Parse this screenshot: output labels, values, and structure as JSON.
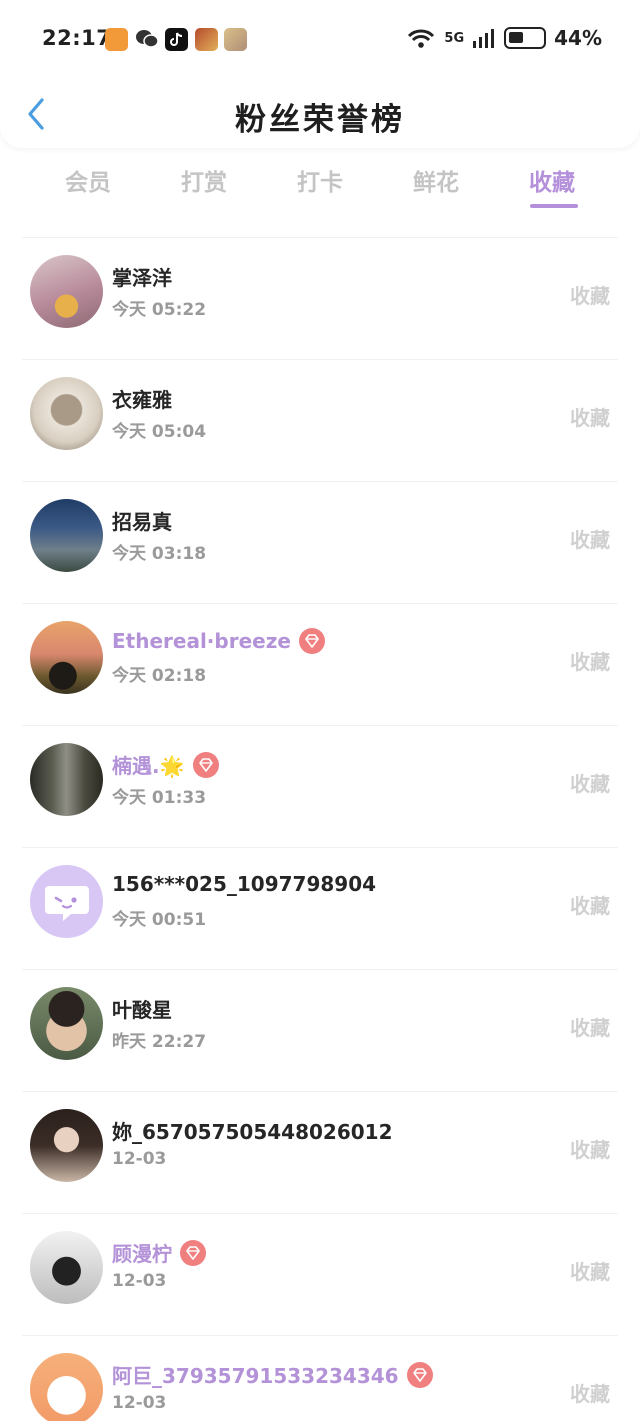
{
  "status_bar": {
    "time": "22:17",
    "network": "5G",
    "battery": "44%"
  },
  "header": {
    "title": "粉丝荣誉榜"
  },
  "tabs": [
    {
      "label": "会员"
    },
    {
      "label": "打赏"
    },
    {
      "label": "打卡"
    },
    {
      "label": "鲜花"
    },
    {
      "label": "收藏"
    }
  ],
  "active_tab_index": 4,
  "colors": {
    "accent": "#b48fda",
    "vip_name": "#b392d8",
    "badge": "#f07f7f",
    "muted": "#c4c4c4"
  },
  "rows": [
    {
      "name": "掌泽洋",
      "time": "今天 05:22",
      "action": "收藏",
      "vip": false,
      "avatar": "paper-crane"
    },
    {
      "name": "衣雍雅",
      "time": "今天 05:04",
      "action": "收藏",
      "vip": false,
      "avatar": "cat"
    },
    {
      "name": "招易真",
      "time": "今天 03:18",
      "action": "收藏",
      "vip": false,
      "avatar": "bridge"
    },
    {
      "name": "Ethereal·breeze",
      "time": "今天 02:18",
      "action": "收藏",
      "vip": true,
      "avatar": "sunset-person"
    },
    {
      "name": "楠遇.🌟",
      "time": "今天 01:33",
      "action": "收藏",
      "vip": true,
      "avatar": "forest"
    },
    {
      "name": "156***025_1097798904",
      "time": "今天 00:51",
      "action": "收藏",
      "vip": false,
      "avatar": "default-chat"
    },
    {
      "name": "叶酸星",
      "time": "昨天 22:27",
      "action": "收藏",
      "vip": false,
      "avatar": "selfie"
    },
    {
      "name": "妳_657057505448026012",
      "time": "12-03",
      "action": "收藏",
      "vip": false,
      "avatar": "portrait-girl"
    },
    {
      "name": "顾漫柠",
      "time": "12-03",
      "action": "收藏",
      "vip": true,
      "avatar": "bw-girl"
    },
    {
      "name": "阿巨_37935791533234346",
      "time": "12-03",
      "action": "收藏",
      "vip": true,
      "avatar": "cartoon-bunny"
    }
  ]
}
